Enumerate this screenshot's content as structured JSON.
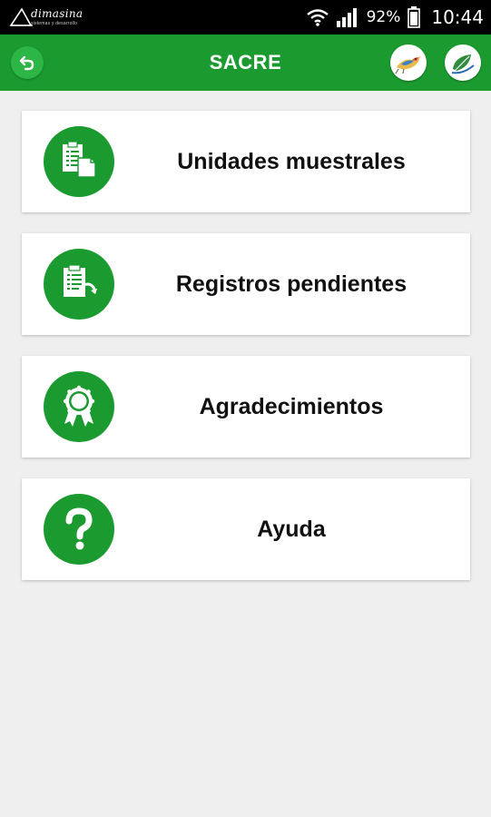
{
  "status_bar": {
    "logo_text": "dimasina",
    "logo_subtext": "sistemas y desarrollo",
    "battery_percent": "92%",
    "time": "10:44",
    "icons": [
      "wifi-icon",
      "signal-icon",
      "battery-icon"
    ]
  },
  "app_bar": {
    "title": "SACRE",
    "back_icon": "back-arrow-icon",
    "logos": [
      "bird-logo",
      "leaf-logo"
    ]
  },
  "menu": {
    "items": [
      {
        "label": "Unidades muestrales",
        "icon": "clipboard-documents-icon"
      },
      {
        "label": "Registros pendientes",
        "icon": "clipboard-refresh-icon"
      },
      {
        "label": "Agradecimientos",
        "icon": "award-ribbon-icon"
      },
      {
        "label": "Ayuda",
        "icon": "question-mark-icon"
      }
    ]
  },
  "colors": {
    "primary_green": "#1b9a30",
    "light_green": "#2bb646",
    "background": "#efefef",
    "card": "#ffffff",
    "status_bar": "#000000"
  }
}
